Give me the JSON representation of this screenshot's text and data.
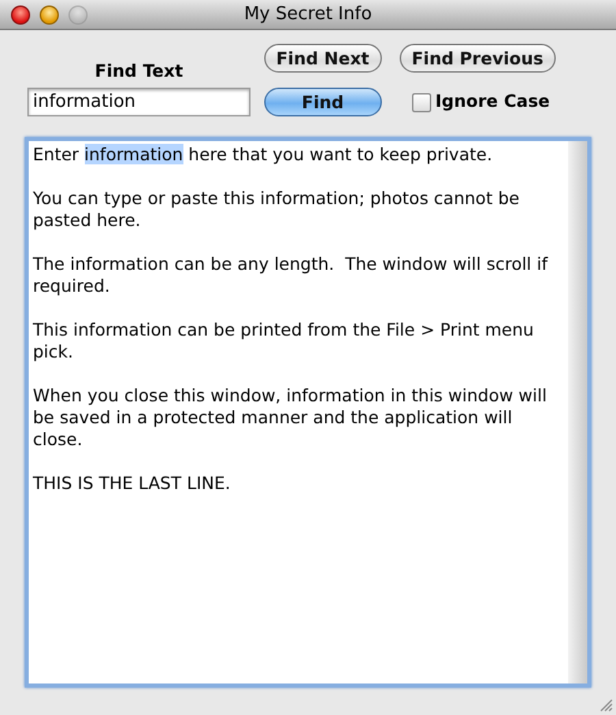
{
  "window": {
    "title": "My Secret Info",
    "buttons": [
      {
        "kind": "close",
        "enabled": true
      },
      {
        "kind": "minimize",
        "enabled": true
      },
      {
        "kind": "zoom",
        "enabled": false
      }
    ]
  },
  "find_label": "Find Text",
  "find_field": {
    "value": "information"
  },
  "buttons": [
    {
      "label": "Find Next",
      "kind": "plain"
    },
    {
      "label": "Find Previous",
      "kind": "plain"
    },
    {
      "label": "Find",
      "kind": "default"
    }
  ],
  "ignore_case": {
    "label": "Ignore Case",
    "checked": false
  },
  "text_area": {
    "paragraphs": [
      [
        {
          "text": "Enter "
        },
        {
          "text": "information",
          "highlighted": true
        },
        {
          "text": " here that you want to keep private."
        }
      ],
      [
        {
          "text": "You can type or paste this information; photos cannot be pasted here."
        }
      ],
      [
        {
          "text": "The information can be any length.  The window will scroll if required."
        }
      ],
      [
        {
          "text": "This information can be printed from the File > Print menu pick."
        }
      ],
      [
        {
          "text": "When you close this window, information in this window will be saved in a protected manner and the application will close."
        }
      ],
      [
        {
          "text": "THIS IS THE LAST LINE."
        }
      ]
    ]
  }
}
